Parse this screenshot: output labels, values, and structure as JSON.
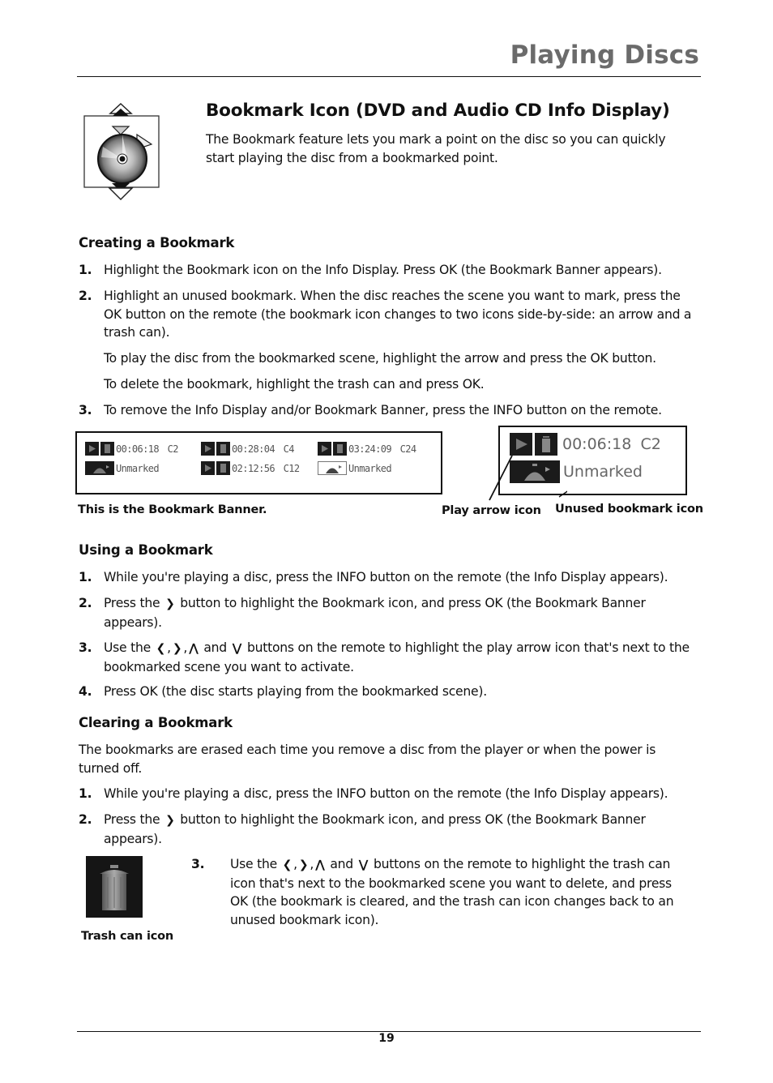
{
  "header": {
    "title": "Playing Discs"
  },
  "section": {
    "title": "Bookmark Icon (DVD and Audio CD Info Display)",
    "intro": "The Bookmark feature lets you mark a point on the disc so you can quickly start playing the disc from a bookmarked point.",
    "icon": "bookmark-disc-icon"
  },
  "creating": {
    "heading": "Creating a Bookmark",
    "steps": [
      {
        "num": "1.",
        "text": "Highlight the Bookmark icon on the Info Display. Press OK (the Bookmark Banner appears)."
      },
      {
        "num": "2.",
        "text": "Highlight an unused bookmark. When the disc reaches the scene you want to mark, press the OK button on the remote (the bookmark icon changes to two icons side-by-side: an arrow and a trash can)."
      },
      {
        "num": "3.",
        "text": "To remove the Info Display and/or Bookmark Banner, press the INFO button on the remote."
      }
    ],
    "note_play": "To play the disc from the bookmarked scene, highlight the arrow and press the OK button.",
    "note_delete": "To delete the bookmark, highlight the trash can and press OK."
  },
  "banner": {
    "entries": [
      {
        "state": "marked",
        "time": "00:06:18",
        "chapter": "C2"
      },
      {
        "state": "unmarked",
        "label": "Unmarked"
      },
      {
        "state": "marked",
        "time": "00:28:04",
        "chapter": "C4"
      },
      {
        "state": "marked",
        "time": "02:12:56",
        "chapter": "C12"
      },
      {
        "state": "marked",
        "time": "03:24:09",
        "chapter": "C24"
      },
      {
        "state": "unmarked-highlighted",
        "label": "Unmarked"
      }
    ],
    "caption": "This is the Bookmark Banner."
  },
  "callout": {
    "time": "00:06:18",
    "chapter": "C2",
    "unmarked_label": "Unmarked",
    "label_play": "Play arrow icon",
    "label_unused": "Unused bookmark icon"
  },
  "using": {
    "heading": "Using a Bookmark",
    "steps": [
      {
        "num": "1.",
        "text": "While you're playing a disc, press the INFO button on the remote (the Info Display appears)."
      },
      {
        "num": "2.",
        "pre": "Press the",
        "post": "button to highlight the Bookmark icon, and press OK (the Bookmark Banner appears)."
      },
      {
        "num": "3.",
        "pre": "Use the",
        "post": "buttons on the remote to highlight the play arrow icon that's next to the bookmarked scene you want to activate."
      },
      {
        "num": "4.",
        "text": "Press OK (the disc starts playing from the bookmarked scene)."
      }
    ]
  },
  "clearing": {
    "heading": "Clearing a Bookmark",
    "intro": "The bookmarks are erased each time you remove a disc from the player or when the power is turned off.",
    "steps": [
      {
        "num": "1.",
        "text": "While you're playing a disc, press the INFO button on the remote (the Info Display appears)."
      },
      {
        "num": "2.",
        "pre": "Press the",
        "post": "button to highlight the Bookmark icon, and press OK (the Bookmark Banner appears)."
      },
      {
        "num": "3.",
        "pre": "Use the",
        "post": "buttons on the remote to highlight the trash can icon that's next to the bookmarked scene you want to delete, and press OK (the bookmark is cleared, and the trash can icon changes back to an unused bookmark icon)."
      }
    ],
    "trash_caption": "Trash can icon"
  },
  "glyphs": {
    "left": "❮",
    "right": "❯",
    "up": "⋀",
    "down": "⋁",
    "and": "and"
  },
  "footer": {
    "page_number": "19"
  }
}
